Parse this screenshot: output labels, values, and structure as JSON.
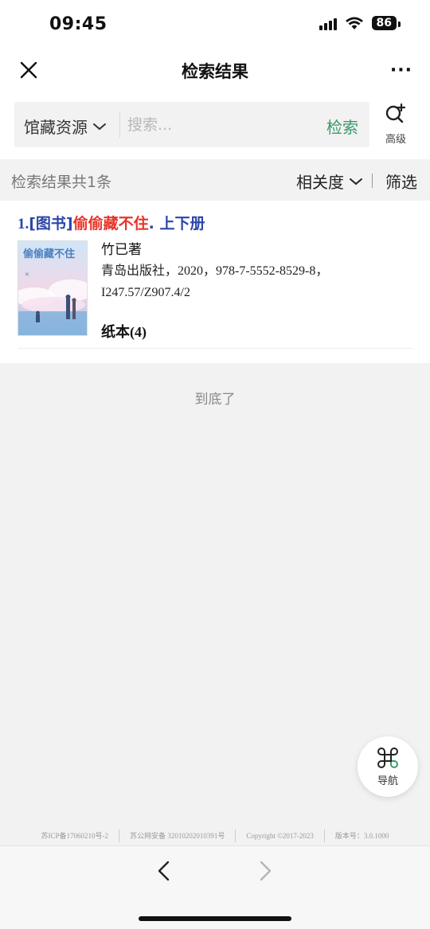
{
  "status_bar": {
    "time": "09:45",
    "battery": "86"
  },
  "nav": {
    "title": "检索结果"
  },
  "search": {
    "scope_label": "馆藏资源",
    "placeholder": "搜索...",
    "button_label": "检索",
    "advanced_label": "高级"
  },
  "summary": {
    "count_text": "检索结果共1条",
    "sort_label": "相关度",
    "filter_label": "筛选"
  },
  "results": [
    {
      "index": "1.",
      "type": "[图书]",
      "title": "偷偷藏不住",
      "title_suffix": ". 上下册",
      "author": "竹已著",
      "publisher": "青岛出版社，",
      "pub_details": "2020，978-7-5552-8529-8，",
      "call_number": "I247.57/Z907.4/2",
      "holding_label": "纸本",
      "holding_count": "(4)",
      "cover_title": "偷偷藏不住"
    }
  ],
  "end_text": "到底了",
  "fab": {
    "label": "导航"
  },
  "footer": {
    "icp": "苏ICP备17060210号-2",
    "police": "苏公网安备 32010202010391号",
    "copyright": "Copyright ©2017-2023",
    "version": "版本号：3.0.1000"
  },
  "colors": {
    "accent_green": "#3a9a6a",
    "link_blue": "#2a46a8",
    "title_red": "#e8352a"
  }
}
